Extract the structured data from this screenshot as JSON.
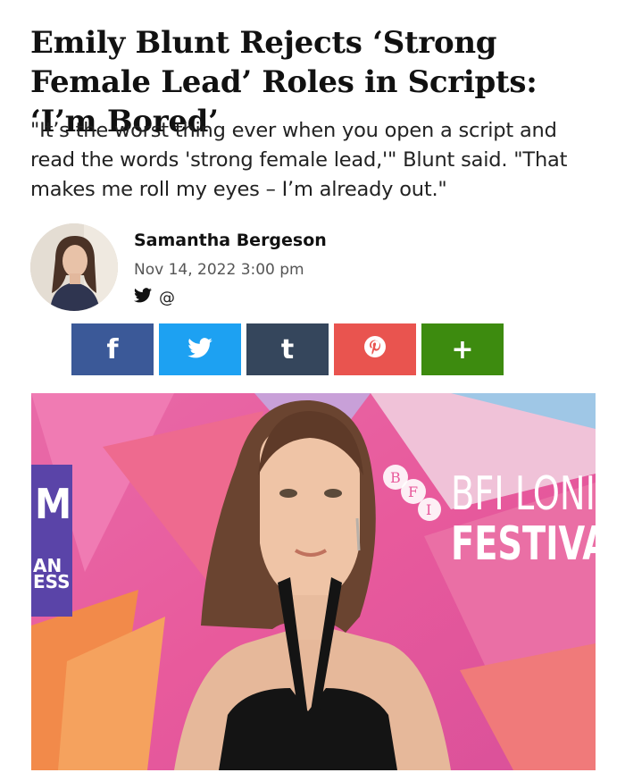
{
  "article": {
    "headline": "Emily Blunt Rejects ‘Strong Female Lead’ Roles in Scripts: ‘I’m Bored’",
    "dek": "\"It’s the worst thing ever when you open a script and read the words 'strong female lead,'\" Blunt said. \"That makes me roll my eyes – I’m already out.\""
  },
  "author": {
    "name": "Samantha Bergeson",
    "date": "Nov 14, 2022 3:00 pm",
    "social": [
      {
        "icon": "twitter-icon",
        "label": ""
      },
      {
        "icon": "at-icon",
        "label": "@"
      }
    ]
  },
  "share": {
    "buttons": [
      {
        "name": "facebook",
        "label": "f",
        "color": "#3b5998"
      },
      {
        "name": "twitter",
        "label": "",
        "color": "#1da1f2"
      },
      {
        "name": "tumblr",
        "label": "t",
        "color": "#35465c"
      },
      {
        "name": "pinterest",
        "label": "",
        "color": "#e9544f"
      },
      {
        "name": "more",
        "label": "+",
        "color": "#3d8b0f"
      }
    ]
  },
  "photo": {
    "backdrop_text": [
      "BFI LONI",
      "FESTIVAL"
    ],
    "side_text": [
      "M",
      "AN",
      "ESS"
    ],
    "logo_letters": [
      "B",
      "F",
      "I"
    ]
  },
  "colors": {
    "backdrop_pink": "#e85a9c",
    "backdrop_orange": "#f28a4a"
  }
}
